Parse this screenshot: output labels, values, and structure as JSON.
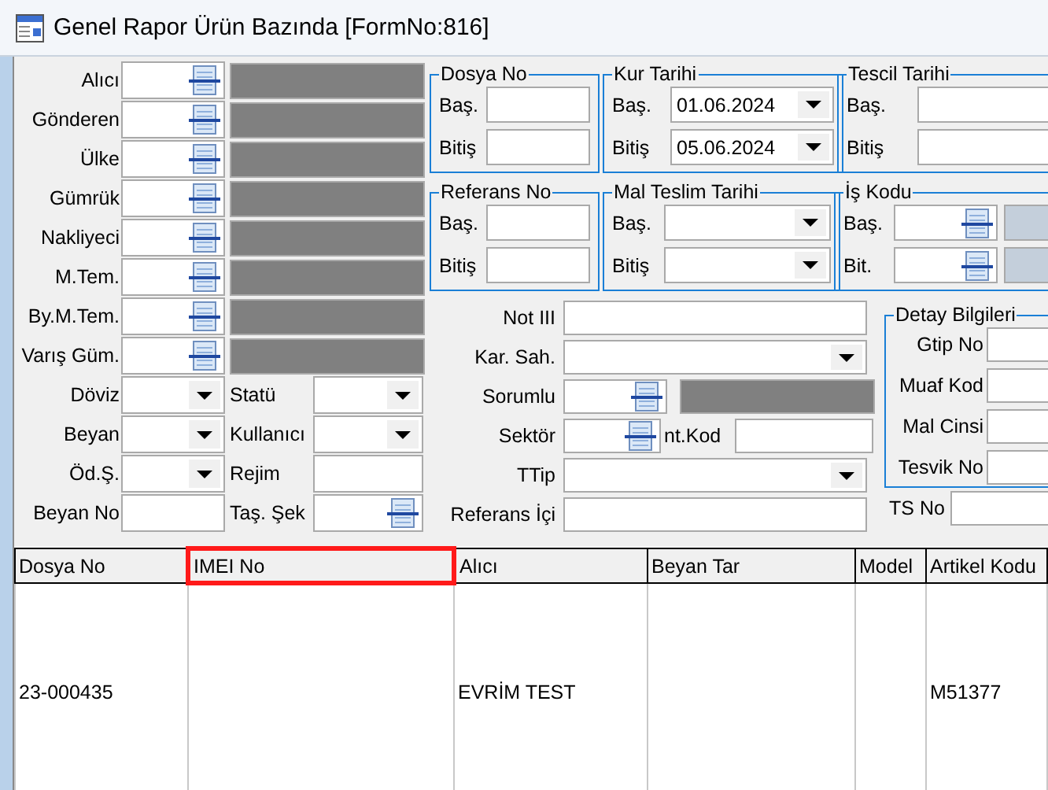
{
  "window": {
    "title": "Genel Rapor Ürün Bazında [FormNo:816]"
  },
  "left_rows": [
    {
      "label": "Alıcı",
      "kind": "lookup"
    },
    {
      "label": "Gönderen",
      "kind": "lookup"
    },
    {
      "label": "Ülke",
      "kind": "lookup"
    },
    {
      "label": "Gümrük",
      "kind": "lookup"
    },
    {
      "label": "Nakliyeci",
      "kind": "lookup"
    },
    {
      "label": "M.Tem.",
      "kind": "lookup"
    },
    {
      "label": "By.M.Tem.",
      "kind": "lookup"
    },
    {
      "label": "Varış Güm.",
      "kind": "lookup"
    }
  ],
  "pair_rows": [
    {
      "fields": [
        {
          "label": "Döviz",
          "kind": "dropdown"
        },
        {
          "label": "Statü",
          "kind": "dropdown"
        }
      ]
    },
    {
      "fields": [
        {
          "label": "Beyan",
          "kind": "dropdown"
        },
        {
          "label": "Kullanıcı",
          "kind": "dropdown"
        }
      ]
    },
    {
      "fields": [
        {
          "label": "Öd.Ş.",
          "kind": "dropdown"
        },
        {
          "label": "Rejim",
          "kind": "text"
        }
      ]
    },
    {
      "fields": [
        {
          "label": "Beyan No",
          "kind": "text"
        },
        {
          "label": "Taş. Şek",
          "kind": "lookup_short"
        }
      ]
    }
  ],
  "groups_top": [
    {
      "title": "Dosya No",
      "rows": [
        {
          "label": "Baş.",
          "kind": "text"
        },
        {
          "label": "Bitiş",
          "kind": "text"
        }
      ]
    },
    {
      "title": "Kur Tarihi",
      "rows": [
        {
          "label": "Baş.",
          "kind": "dropdown",
          "value": "01.06.2024"
        },
        {
          "label": "Bitiş",
          "kind": "dropdown",
          "value": "05.06.2024"
        }
      ]
    },
    {
      "title": "Tescil Tarihi",
      "rows": [
        {
          "label": "Baş.",
          "kind": "text"
        },
        {
          "label": "Bitiş",
          "kind": "text"
        }
      ]
    }
  ],
  "groups_second": [
    {
      "title": "Referans No",
      "rows": [
        {
          "label": "Baş.",
          "kind": "text"
        },
        {
          "label": "Bitiş",
          "kind": "text"
        }
      ]
    },
    {
      "title": "Mal Teslim Tarihi",
      "rows": [
        {
          "label": "Baş.",
          "kind": "dropdown"
        },
        {
          "label": "Bitiş",
          "kind": "dropdown"
        }
      ]
    },
    {
      "title": "İş Kodu",
      "rows": [
        {
          "label": "Baş.",
          "kind": "lookup_light"
        },
        {
          "label": "Bit.",
          "kind": "lookup_light"
        }
      ]
    }
  ],
  "middle_rows": [
    {
      "label": "Not III",
      "kind": "text"
    },
    {
      "label": "Kar. Sah.",
      "kind": "dropdown"
    },
    {
      "label": "Sorumlu",
      "kind": "lookup"
    },
    {
      "label": "Sektör",
      "kind": "lookup_label_text",
      "extra_label": "nt.Kod"
    },
    {
      "label": "TTip",
      "kind": "dropdown"
    },
    {
      "label": "Referans İçi",
      "kind": "text"
    }
  ],
  "detail_group": {
    "title": "Detay Bilgileri",
    "rows": [
      {
        "label": "Gtip No",
        "kind": "text"
      },
      {
        "label": "Muaf Kod",
        "kind": "text"
      },
      {
        "label": "Mal Cinsi",
        "kind": "text"
      },
      {
        "label": "Tesvik No",
        "kind": "text"
      }
    ]
  },
  "ts_no": {
    "label": "TS No",
    "kind": "text"
  },
  "table": {
    "columns": [
      {
        "label": "Dosya No",
        "highlighted": false
      },
      {
        "label": "IMEI No",
        "highlighted": true
      },
      {
        "label": "Alıcı",
        "highlighted": false
      },
      {
        "label": "Beyan Tar",
        "highlighted": false
      },
      {
        "label": "Model",
        "highlighted": false
      },
      {
        "label": "Artikel Kodu",
        "highlighted": false
      }
    ],
    "rows": [
      {
        "cells": [
          "23-000435",
          null,
          "EVRİM TEST",
          null,
          null,
          "M51377"
        ]
      }
    ]
  }
}
